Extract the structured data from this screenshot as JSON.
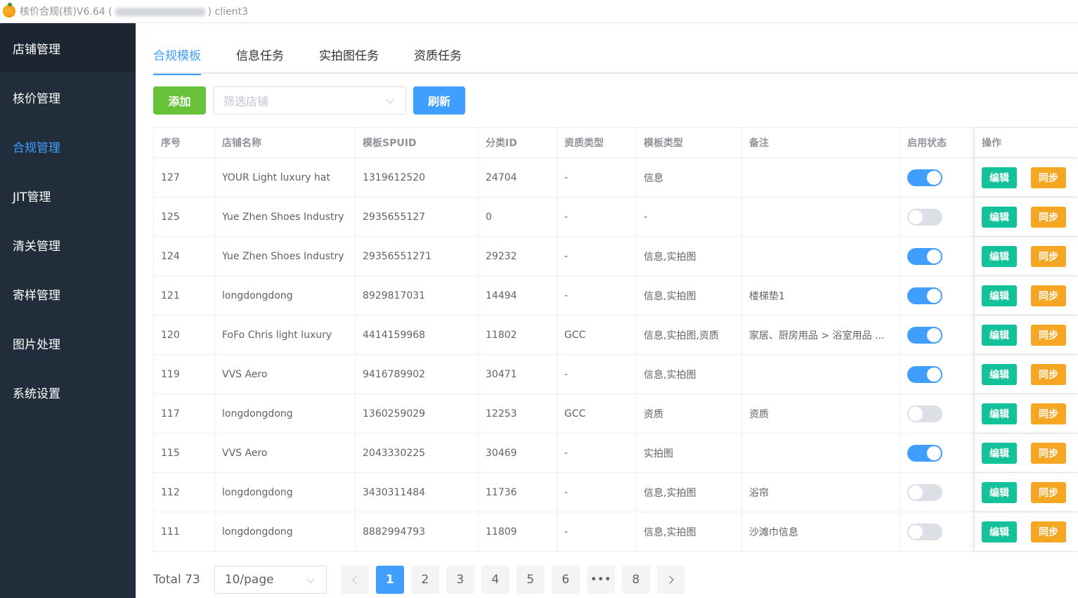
{
  "titlebar": {
    "title_prefix": "核价合规(核)V6.64 (",
    "title_suffix": ") client3"
  },
  "sidebar": {
    "items": [
      {
        "label": "店铺管理"
      },
      {
        "label": "核价管理"
      },
      {
        "label": "合规管理"
      },
      {
        "label": "JIT管理"
      },
      {
        "label": "清关管理"
      },
      {
        "label": "寄样管理"
      },
      {
        "label": "图片处理"
      },
      {
        "label": "系统设置"
      }
    ],
    "active_index": 2
  },
  "tabs": [
    {
      "label": "合规模板"
    },
    {
      "label": "信息任务"
    },
    {
      "label": "实拍图任务"
    },
    {
      "label": "资质任务"
    }
  ],
  "toolbar": {
    "add_label": "添加",
    "filter_placeholder": "筛选店铺",
    "refresh_label": "刷新"
  },
  "table": {
    "headers": [
      "序号",
      "店铺名称",
      "模板SPUID",
      "分类ID",
      "资质类型",
      "模板类型",
      "备注",
      "启用状态",
      "操作"
    ],
    "edit_label": "编辑",
    "sync_label": "同步",
    "rows": [
      {
        "id": "127",
        "shop": "YOUR Light luxury hat",
        "spuid": "1319612520",
        "cat": "24704",
        "qual": "-",
        "ttype": "信息",
        "note": "",
        "enabled": true
      },
      {
        "id": "125",
        "shop": "Yue Zhen Shoes Industry",
        "spuid": "2935655127",
        "cat": "0",
        "qual": "-",
        "ttype": "-",
        "note": "",
        "enabled": false
      },
      {
        "id": "124",
        "shop": "Yue Zhen Shoes Industry",
        "spuid": "29356551271",
        "cat": "29232",
        "qual": "-",
        "ttype": "信息,实拍图",
        "note": "",
        "enabled": true
      },
      {
        "id": "121",
        "shop": "longdongdong",
        "spuid": "8929817031",
        "cat": "14494",
        "qual": "-",
        "ttype": "信息,实拍图",
        "note": "楼梯垫1",
        "enabled": true
      },
      {
        "id": "120",
        "shop": "FoFo Chris light luxury",
        "spuid": "4414159968",
        "cat": "11802",
        "qual": "GCC",
        "ttype": "信息,实拍图,资质",
        "note": "家居、厨房用品 > 浴室用品 ...",
        "enabled": true
      },
      {
        "id": "119",
        "shop": "VVS Aero",
        "spuid": "9416789902",
        "cat": "30471",
        "qual": "-",
        "ttype": "信息,实拍图",
        "note": "",
        "enabled": true
      },
      {
        "id": "117",
        "shop": "longdongdong",
        "spuid": "1360259029",
        "cat": "12253",
        "qual": "GCC",
        "ttype": "资质",
        "note": "资质",
        "enabled": false
      },
      {
        "id": "115",
        "shop": "VVS Aero",
        "spuid": "2043330225",
        "cat": "30469",
        "qual": "-",
        "ttype": "实拍图",
        "note": "",
        "enabled": true
      },
      {
        "id": "112",
        "shop": "longdongdong",
        "spuid": "3430311484",
        "cat": "11736",
        "qual": "-",
        "ttype": "信息,实拍图",
        "note": "浴帘",
        "enabled": false
      },
      {
        "id": "111",
        "shop": "longdongdong",
        "spuid": "8882994793",
        "cat": "11809",
        "qual": "-",
        "ttype": "信息,实拍图",
        "note": "沙滩巾信息",
        "enabled": false
      }
    ]
  },
  "pagination": {
    "total_label": "Total 73",
    "page_size": "10/page",
    "pages": [
      "1",
      "2",
      "3",
      "4",
      "5",
      "6",
      "•••",
      "8"
    ],
    "current": "1"
  },
  "colors": {
    "accent": "#409eff",
    "add": "#67c23a",
    "edit": "#13c19a",
    "sync": "#f5a623",
    "sidebar": "#222d3b"
  }
}
